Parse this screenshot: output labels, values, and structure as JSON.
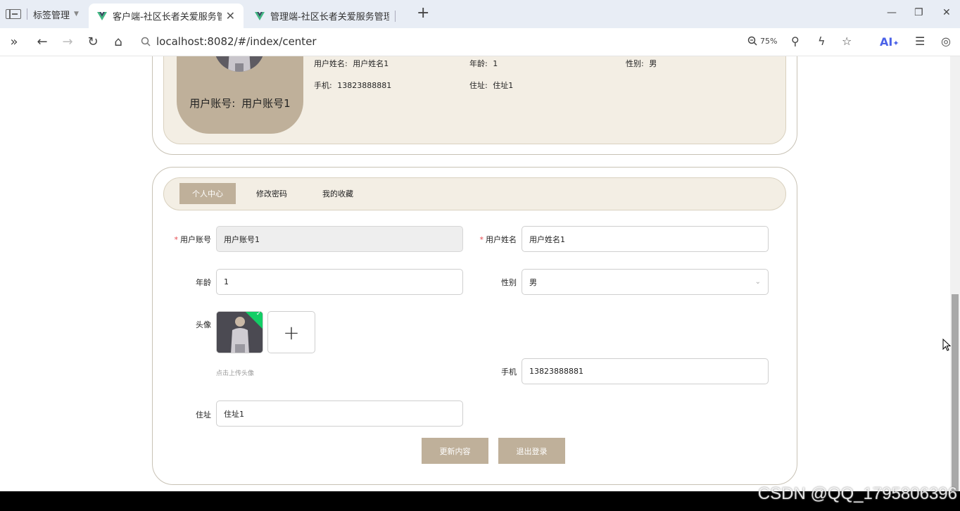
{
  "browser": {
    "tab_group_label": "标签管理",
    "tabs": [
      {
        "title": "客户端-社区长者关爱服务管理"
      },
      {
        "title": "管理端-社区长者关爱服务管理系"
      }
    ],
    "url": "localhost:8082/#/index/center",
    "zoom": "75%",
    "ai_label": "AI",
    "accent_color": "#4b62e8"
  },
  "profile": {
    "account_label": "用户账号:",
    "account_value": "用户账号1",
    "name_label": "用户姓名:",
    "name_value": "用户姓名1",
    "age_label": "年龄:",
    "age_value": "1",
    "gender_label": "性别:",
    "gender_value": "男",
    "phone_label": "手机:",
    "phone_value": "13823888881",
    "address_label": "住址:",
    "address_value": "住址1"
  },
  "center_tabs": [
    {
      "label": "个人中心",
      "active": true
    },
    {
      "label": "修改密码",
      "active": false
    },
    {
      "label": "我的收藏",
      "active": false
    }
  ],
  "form": {
    "account_label": "用户账号",
    "account_value": "用户账号1",
    "name_label": "用户姓名",
    "name_value": "用户姓名1",
    "age_label": "年龄",
    "age_value": "1",
    "gender_label": "性别",
    "gender_value": "男",
    "avatar_label": "头像",
    "upload_tip": "点击上传头像",
    "phone_label": "手机",
    "phone_value": "13823888881",
    "address_label": "住址",
    "address_value": "住址1",
    "required_mark": "*"
  },
  "buttons": {
    "update": "更新内容",
    "logout": "退出登录"
  },
  "theme": {
    "primary": "#bfb09a",
    "panel": "#f3eee4",
    "success": "#13ce66"
  },
  "watermark": "CSDN @QQ_1795806396"
}
